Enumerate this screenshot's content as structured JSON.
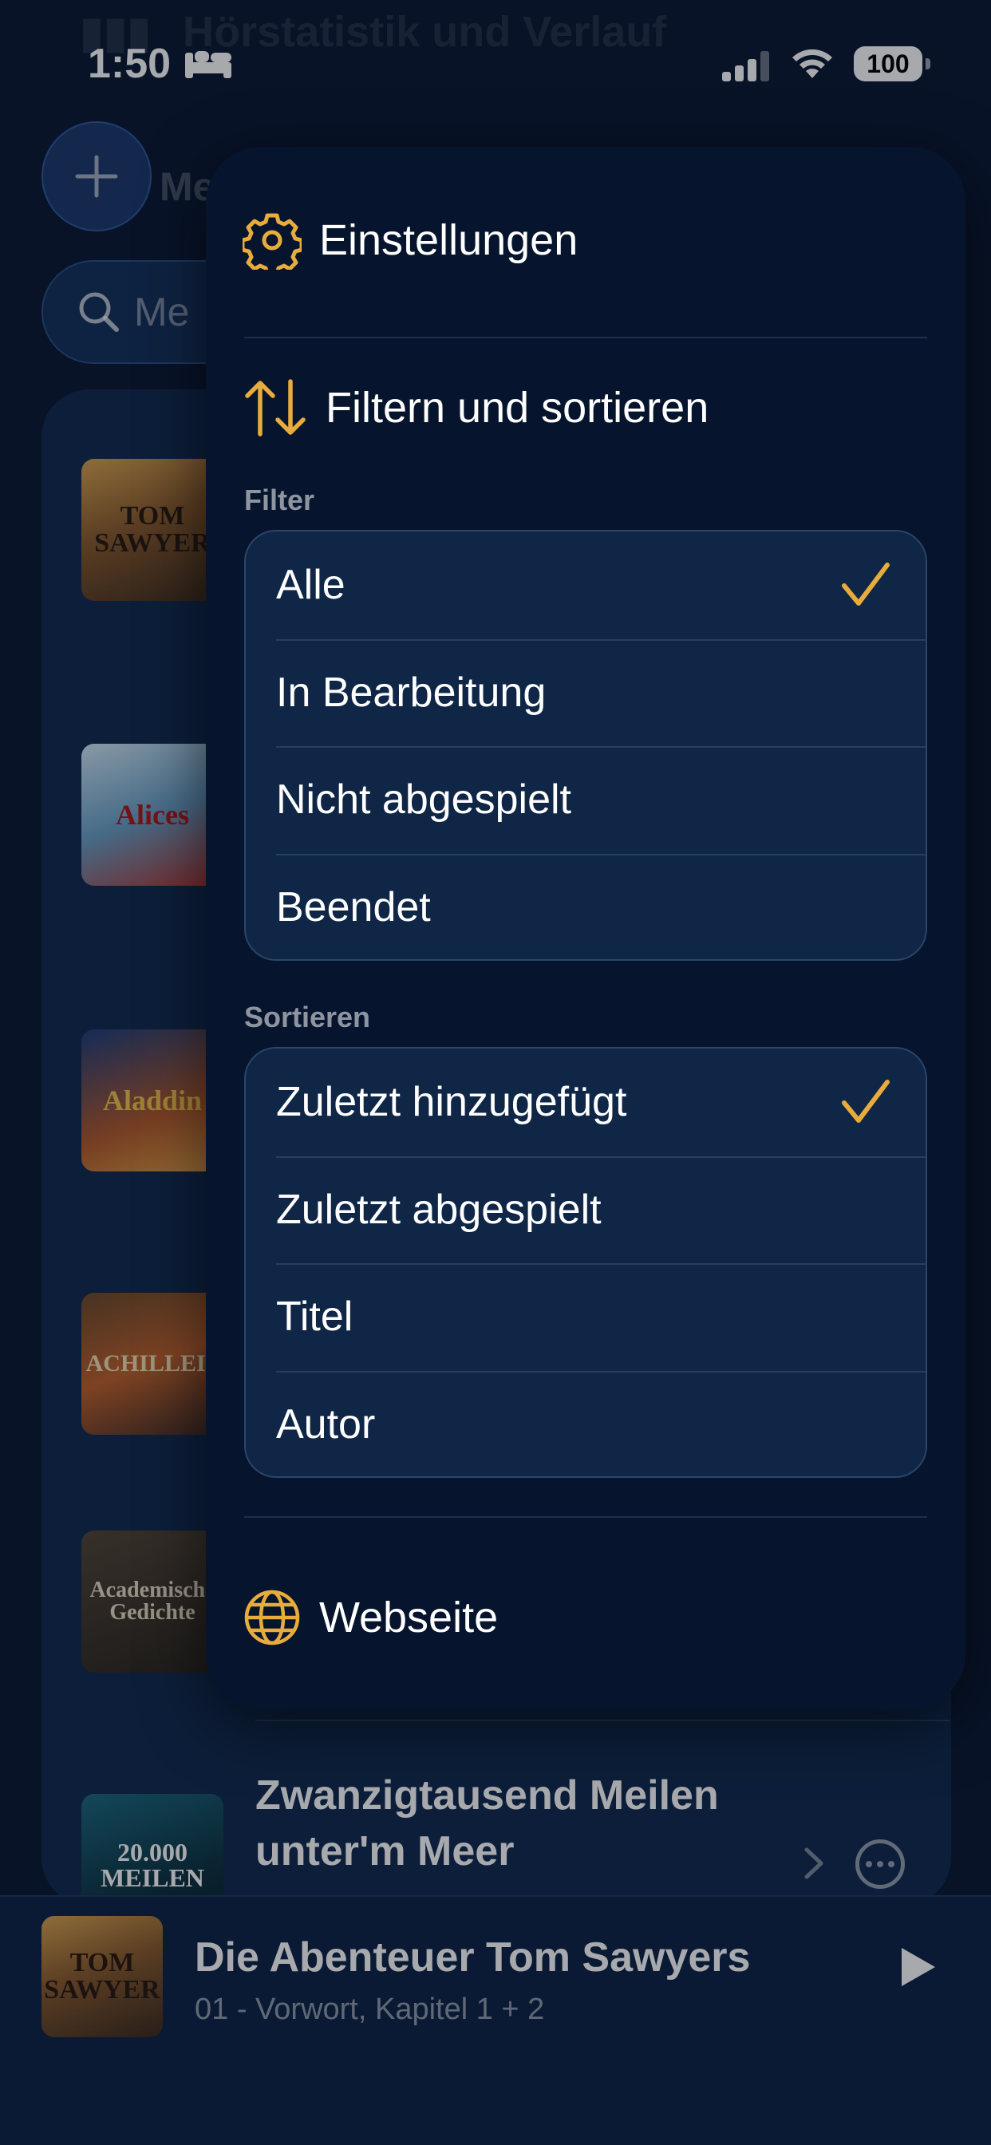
{
  "status_bar": {
    "time": "1:50",
    "battery": "100"
  },
  "background": {
    "header_ghost": "Hörstatistik und Verlauf",
    "title_ghost": "Meine",
    "search_placeholder": "Me",
    "covers": [
      {
        "title": "TOM SAWYER"
      },
      {
        "title": "Alices"
      },
      {
        "title": "Aladdin"
      },
      {
        "title": "ACHILLEIS"
      },
      {
        "title": "Academische Gedichte"
      },
      {
        "title": "20.000 MEILEN"
      }
    ],
    "visible_book_title": "Zwanzigtausend Meilen unter'm Meer"
  },
  "menu": {
    "settings_label": "Einstellungen",
    "filter_sort_label": "Filtern und sortieren",
    "filter_section": "Filter",
    "filter_options": [
      "Alle",
      "In Bearbeitung",
      "Nicht abgespielt",
      "Beendet"
    ],
    "filter_selected": "Alle",
    "sort_section": "Sortieren",
    "sort_options": [
      "Zuletzt hinzugefügt",
      "Zuletzt abgespielt",
      "Titel",
      "Autor"
    ],
    "sort_selected": "Zuletzt hinzugefügt",
    "website_label": "Webseite"
  },
  "now_playing": {
    "cover_title": "TOM SAWYER",
    "title": "Die Abenteuer Tom Sawyers",
    "subtitle": "01 - Vorwort, Kapitel 1 + 2"
  },
  "colors": {
    "accent": "#e8ac3c",
    "background": "#0b1a33",
    "menu": "#06152d"
  }
}
